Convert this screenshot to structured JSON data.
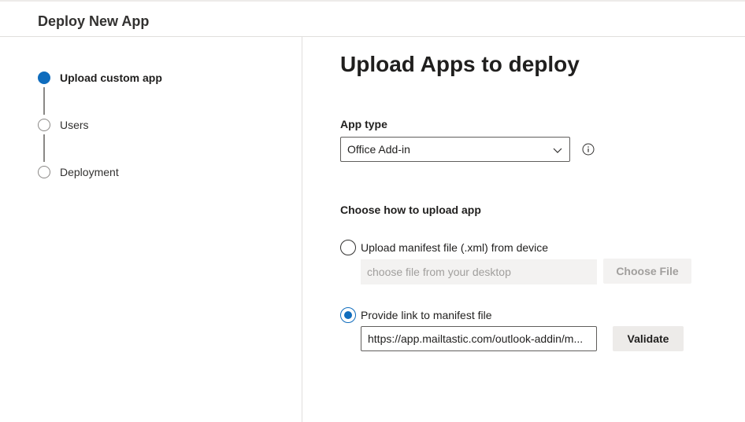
{
  "header": {
    "title": "Deploy New App"
  },
  "stepper": {
    "steps": [
      {
        "label": "Upload custom app",
        "active": true
      },
      {
        "label": "Users",
        "active": false
      },
      {
        "label": "Deployment",
        "active": false
      }
    ]
  },
  "main": {
    "title": "Upload Apps to deploy",
    "app_type": {
      "label": "App type",
      "selected": "Office Add-in",
      "info_icon": "info-icon"
    },
    "upload_section": {
      "label": "Choose how to upload app",
      "option_file": {
        "label": "Upload manifest file (.xml) from device",
        "checked": false,
        "placeholder": "choose file from your desktop",
        "button": "Choose File"
      },
      "option_link": {
        "label": "Provide link to manifest file",
        "checked": true,
        "value": "https://app.mailtastic.com/outlook-addin/m...",
        "button": "Validate"
      }
    }
  },
  "colors": {
    "accent": "#0f6cbd",
    "border": "#605e5c",
    "disabled_bg": "#f3f2f1"
  }
}
